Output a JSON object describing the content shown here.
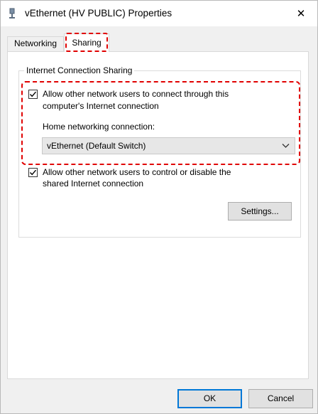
{
  "window": {
    "title": "vEthernet (HV PUBLIC) Properties",
    "close_glyph": "✕"
  },
  "tabs": [
    {
      "label": "Networking",
      "selected": false
    },
    {
      "label": "Sharing",
      "selected": true
    }
  ],
  "group": {
    "legend": "Internet Connection Sharing",
    "allow_connect": {
      "checked": true,
      "line1": "Allow other network users to connect through this",
      "line2": "computer's Internet connection"
    },
    "home_label": "Home networking connection:",
    "home_select": {
      "value": "vEthernet (Default Switch)"
    },
    "allow_control": {
      "checked": true,
      "line1": "Allow other network users to control or disable the",
      "line2": "shared Internet connection"
    },
    "settings_button": "Settings..."
  },
  "footer": {
    "ok_button": "OK",
    "cancel_button": "Cancel"
  },
  "icons": {
    "title": "network-adapter-icon",
    "close": "close-icon",
    "check": "checkmark-icon",
    "dropdown": "chevron-down-icon"
  },
  "colors": {
    "highlight": "#e00000",
    "focus": "#0078d7",
    "panel": "#ffffff",
    "dialog": "#f0f0f0"
  }
}
